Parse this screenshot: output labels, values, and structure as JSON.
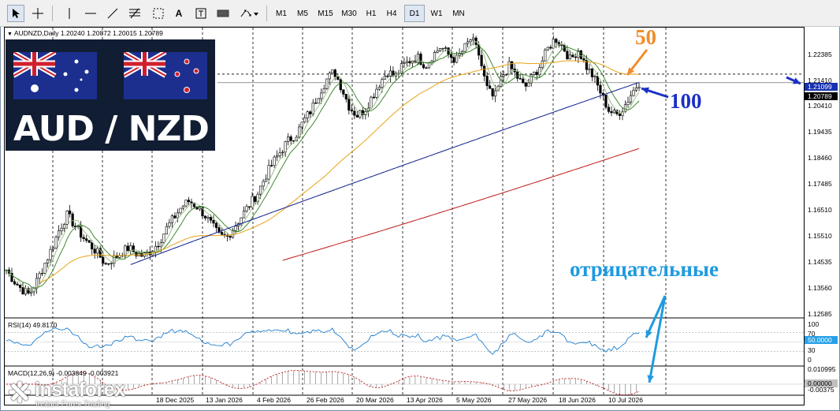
{
  "toolbar": {
    "tool_icons": [
      "cursor-icon",
      "crosshair-icon",
      "vertical-line-icon",
      "horizontal-line-icon",
      "trendline-icon",
      "fibonacci-icon",
      "text-icon",
      "label-icon",
      "rectangle-icon",
      "arrows-icon"
    ],
    "timeframes": [
      "M1",
      "M5",
      "M15",
      "M30",
      "H1",
      "H4",
      "D1",
      "W1",
      "MN"
    ],
    "active_timeframe": "D1",
    "text_tool": "A"
  },
  "chart_header": {
    "symbol_line": "AUDNZD,Daily  1.20240 1.20872 1.20015 1.20789"
  },
  "logo": {
    "pair": "AUD / NZD"
  },
  "annotations": {
    "ma50": "50",
    "ma100": "100",
    "negative": "отрицательные"
  },
  "price_axis": {
    "ticks": [
      "1.22385",
      "1.21410",
      "1.20410",
      "1.19435",
      "1.18460",
      "1.17485",
      "1.16510",
      "1.15510",
      "1.14535",
      "1.13560",
      "1.12585"
    ],
    "tag_ma": "1.21099",
    "tag_price": "1.20789"
  },
  "rsi": {
    "label": "RSI(14) 49.8170",
    "levels": [
      "100",
      "70",
      "30",
      "0"
    ],
    "value_tag": "50.0000"
  },
  "macd": {
    "label": "MACD(12,26,9) -0.003849 -0.003921",
    "levels": [
      "0.010995",
      "0.00000",
      "-0.00375"
    ]
  },
  "date_axis": [
    "18 Dec 2025",
    "13 Jan 2026",
    "4 Feb 2026",
    "26 Feb 2026",
    "20 Mar 2026",
    "13 Apr 2026",
    "5 May 2026",
    "27 May 2026",
    "18 Jun 2026",
    "10 Jul 2026"
  ],
  "watermark": {
    "name": "instaforex",
    "tagline": "Instant Forex Trading"
  },
  "colors": {
    "ma50": "#e8a317",
    "ma100": "#10208c",
    "ma200": "#c01818",
    "fast_ma": "#2e7d1e",
    "rsi": "#1f7fd1",
    "macd": "#c01818",
    "annot_blue": "#1a2fc7",
    "annot_orange": "#f28c28",
    "annot_cyan": "#1f9ae0"
  },
  "chart_data": {
    "type": "candlestick",
    "symbol": "AUDNZD",
    "timeframe": "Daily",
    "ohlc_last": {
      "open": 1.2024,
      "high": 1.20872,
      "low": 1.20015,
      "close": 1.20789
    },
    "y_range": [
      1.12285,
      1.22785
    ],
    "x_dates": [
      "18 Dec 2025",
      "13 Jan 2026",
      "4 Feb 2026",
      "26 Feb 2026",
      "20 Mar 2026",
      "13 Apr 2026",
      "5 May 2026",
      "27 May 2026",
      "18 Jun 2026",
      "10 Jul 2026"
    ],
    "close_path": [
      1.14,
      1.136,
      1.133,
      1.131,
      1.136,
      1.142,
      1.148,
      1.155,
      1.16,
      1.156,
      1.152,
      1.149,
      1.146,
      1.142,
      1.144,
      1.146,
      1.148,
      1.146,
      1.145,
      1.147,
      1.15,
      1.155,
      1.159,
      1.163,
      1.165,
      1.163,
      1.16,
      1.156,
      1.152,
      1.152,
      1.156,
      1.16,
      1.164,
      1.168,
      1.174,
      1.179,
      1.183,
      1.187,
      1.189,
      1.194,
      1.198,
      1.204,
      1.209,
      1.212,
      1.206,
      1.199,
      1.196,
      1.198,
      1.203,
      1.208,
      1.212,
      1.21,
      1.214,
      1.216,
      1.217,
      1.214,
      1.218,
      1.221,
      1.218,
      1.216,
      1.22,
      1.224,
      1.218,
      1.206,
      1.202,
      1.21,
      1.214,
      1.21,
      1.206,
      1.21,
      1.214,
      1.22,
      1.224,
      1.221,
      1.216,
      1.22,
      1.214,
      1.21,
      1.204,
      1.198,
      1.196,
      1.199,
      1.204,
      1.208
    ],
    "ma_levels": {
      "ma50_last": 1.21099,
      "ma100_last": 1.208,
      "ma200_last": 1.184
    },
    "grid": true
  }
}
